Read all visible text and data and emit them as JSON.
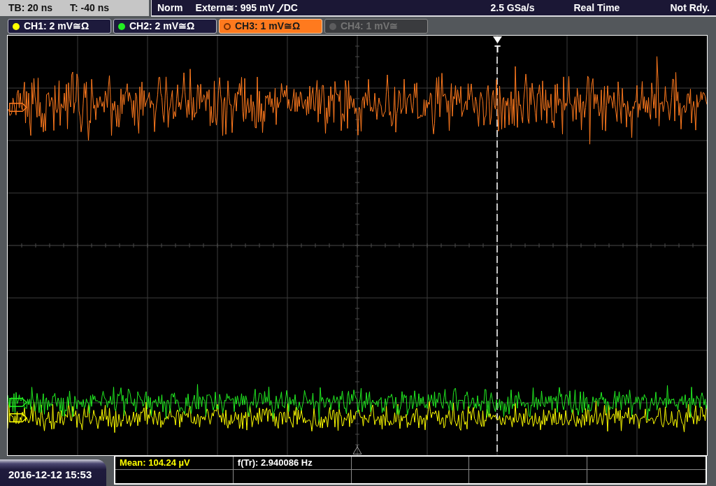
{
  "status_bar": {
    "timebase": "TB: 20 ns",
    "trigger_time": "T: -40 ns",
    "trigger_mode": "Norm",
    "trigger_source": "Extern≅: 995 mV",
    "coupling": "DC",
    "sample_rate": "2.5 GSa/s",
    "acquisition_mode": "Real Time",
    "status": "Not Rdy."
  },
  "channels": [
    {
      "label": "CH1: 2 mV≅Ω",
      "color": "#ffff00",
      "selected": false,
      "disabled": false
    },
    {
      "label": "CH2: 2 mV≅Ω",
      "color": "#22ee22",
      "selected": false,
      "disabled": false
    },
    {
      "label": "CH3: 1 mV≅Ω",
      "color": "#ff7a1e",
      "selected": true,
      "disabled": false
    },
    {
      "label": "CH4: 1 mV≅",
      "color": "#5c5c5e",
      "selected": false,
      "disabled": true
    }
  ],
  "screen": {
    "trigger_label": "T"
  },
  "footer": {
    "date_time": "2016-12-12 15:53",
    "measurements": [
      {
        "label": "Mean: 104.24 µV",
        "color": "#ffff00"
      },
      {
        "label": "f(Tr): 2.940086 Hz",
        "color": "#ffffff"
      }
    ]
  }
}
